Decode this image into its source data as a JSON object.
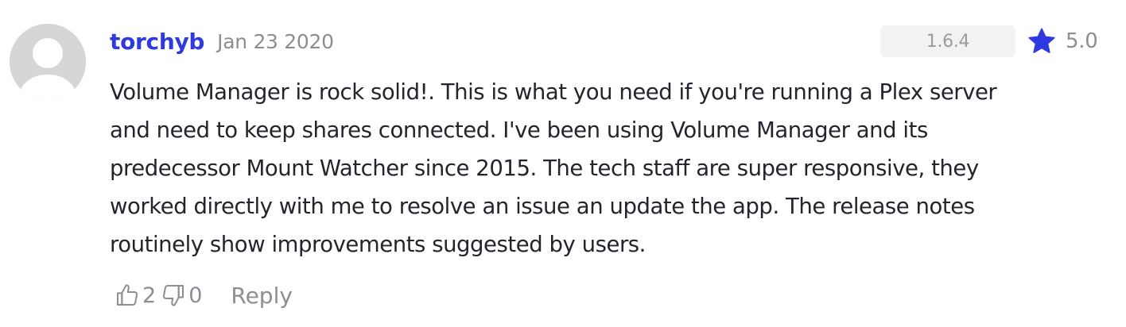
{
  "review": {
    "author": "torchyb",
    "date": "Jan 23 2020",
    "version": "1.6.4",
    "rating": "5.0",
    "rating_icon": "star-icon",
    "accent_color": "#2e39e0",
    "body_lines": [
      "Volume Manager is rock solid!. This is what you need if you're running a Plex server",
      "and need to keep shares connected. I've been using Volume Manager and its",
      "predecessor Mount Watcher since 2015. The tech staff are super responsive, they",
      "worked directly with me to resolve an issue an update the app. The release notes",
      "routinely show improvements suggested by users."
    ],
    "actions": {
      "upvote_icon": "thumbs-up-icon",
      "upvotes": "2",
      "downvote_icon": "thumbs-down-icon",
      "downvotes": "0",
      "reply_label": "Reply"
    }
  }
}
